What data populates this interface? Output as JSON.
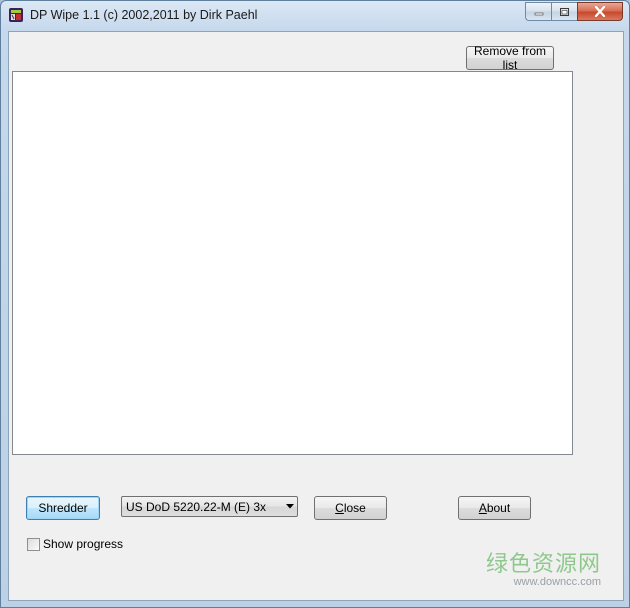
{
  "window": {
    "title": "DP Wipe 1.1 (c) 2002,2011 by Dirk Paehl"
  },
  "toolbar": {
    "remove_label": "Remove from list"
  },
  "file_list": {
    "items": []
  },
  "controls": {
    "shredder_label": "Shredder",
    "method_selected": "US DoD 5220.22-M (E) 3x",
    "close_label": "Close",
    "about_label": "About",
    "show_progress_label": "Show progress",
    "show_progress_checked": false
  },
  "watermark": {
    "text": "绿色资源网",
    "url": "www.downcc.com"
  },
  "colors": {
    "close_button": "#c74a2d",
    "default_button_border": "#3c7fb1",
    "watermark_green": "#7ec27b"
  }
}
